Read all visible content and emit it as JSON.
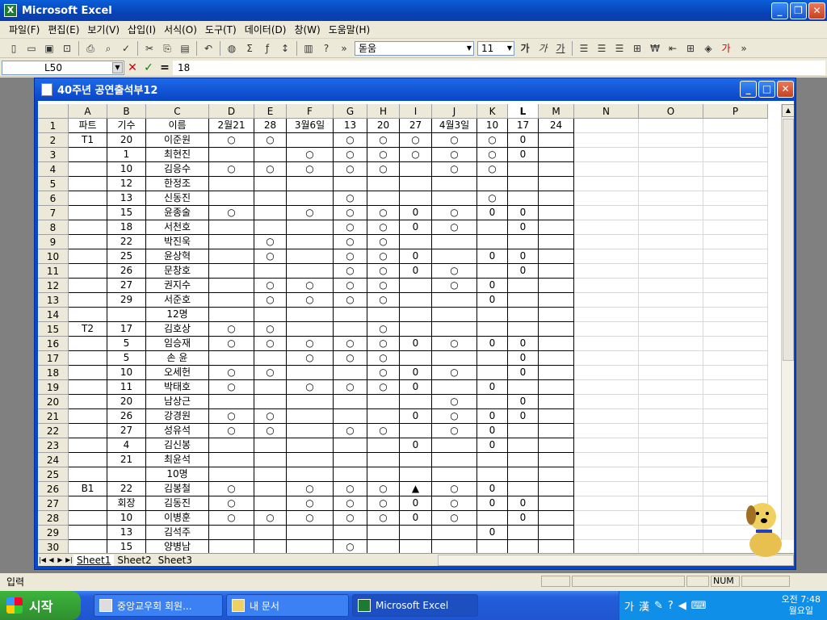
{
  "app": {
    "title": "Microsoft Excel"
  },
  "menu": [
    "파일(F)",
    "편집(E)",
    "보기(V)",
    "삽입(I)",
    "서식(O)",
    "도구(T)",
    "데이터(D)",
    "창(W)",
    "도움말(H)"
  ],
  "toolbar": {
    "font": "돋움",
    "size": "11",
    "bold": "가",
    "italic": "가",
    "underline": "가"
  },
  "formula": {
    "cell": "L50",
    "value": "18",
    "cancel": "✕",
    "enter": "✓",
    "eq": "="
  },
  "workbook": {
    "title": "40주년 공연출석부12"
  },
  "columns": [
    "A",
    "B",
    "C",
    "D",
    "E",
    "F",
    "G",
    "H",
    "I",
    "J",
    "K",
    "L",
    "M",
    "N",
    "O",
    "P"
  ],
  "rows": [
    {
      "n": "1",
      "cells": [
        "파트",
        "기수",
        "이름",
        "2월21",
        "28",
        "3월6일",
        "13",
        "20",
        "27",
        "4월3일",
        "10",
        "17",
        "24"
      ]
    },
    {
      "n": "2",
      "cells": [
        "T1",
        "20",
        "이준원",
        "○",
        "○",
        "",
        "○",
        "○",
        "○",
        "○",
        "○",
        "0",
        ""
      ]
    },
    {
      "n": "3",
      "cells": [
        "",
        "1",
        "최현진",
        "",
        "",
        "○",
        "○",
        "○",
        "○",
        "○",
        "○",
        "0",
        ""
      ]
    },
    {
      "n": "4",
      "cells": [
        "",
        "10",
        "김응수",
        "○",
        "○",
        "○",
        "○",
        "○",
        "",
        "○",
        "○",
        "",
        ""
      ]
    },
    {
      "n": "5",
      "cells": [
        "",
        "12",
        "한정조",
        "",
        "",
        "",
        "",
        "",
        "",
        "",
        "",
        "",
        ""
      ]
    },
    {
      "n": "6",
      "cells": [
        "",
        "13",
        "신동진",
        "",
        "",
        "",
        "○",
        "",
        "",
        "",
        "○",
        "",
        ""
      ]
    },
    {
      "n": "7",
      "cells": [
        "",
        "15",
        "윤종술",
        "○",
        "",
        "○",
        "○",
        "○",
        "0",
        "○",
        "0",
        "0",
        ""
      ]
    },
    {
      "n": "8",
      "cells": [
        "",
        "18",
        "서천호",
        "",
        "",
        "",
        "○",
        "○",
        "0",
        "○",
        "",
        "0",
        ""
      ]
    },
    {
      "n": "9",
      "cells": [
        "",
        "22",
        "박진욱",
        "",
        "○",
        "",
        "○",
        "○",
        "",
        "",
        "",
        "",
        ""
      ]
    },
    {
      "n": "10",
      "cells": [
        "",
        "25",
        "윤상혁",
        "",
        "○",
        "",
        "○",
        "○",
        "0",
        "",
        "0",
        "0",
        ""
      ]
    },
    {
      "n": "11",
      "cells": [
        "",
        "26",
        "문창호",
        "",
        "",
        "",
        "○",
        "○",
        "0",
        "○",
        "",
        "0",
        ""
      ]
    },
    {
      "n": "12",
      "cells": [
        "",
        "27",
        "권지수",
        "",
        "○",
        "○",
        "○",
        "○",
        "",
        "○",
        "0",
        "",
        ""
      ]
    },
    {
      "n": "13",
      "cells": [
        "",
        "29",
        "서준호",
        "",
        "○",
        "○",
        "○",
        "○",
        "",
        "",
        "0",
        "",
        ""
      ]
    },
    {
      "n": "14",
      "cells": [
        "",
        "",
        "12명",
        "",
        "",
        "",
        "",
        "",
        "",
        "",
        "",
        "",
        ""
      ]
    },
    {
      "n": "15",
      "cells": [
        "T2",
        "17",
        "김호상",
        "○",
        "○",
        "",
        "",
        "○",
        "",
        "",
        "",
        "",
        ""
      ]
    },
    {
      "n": "16",
      "cells": [
        "",
        "5",
        "임승재",
        "○",
        "○",
        "○",
        "○",
        "○",
        "0",
        "○",
        "0",
        "0",
        ""
      ]
    },
    {
      "n": "17",
      "cells": [
        "",
        "5",
        "손 윤",
        "",
        "",
        "○",
        "○",
        "○",
        "",
        "",
        "",
        "0",
        ""
      ]
    },
    {
      "n": "18",
      "cells": [
        "",
        "10",
        "오세헌",
        "○",
        "○",
        "",
        "",
        "○",
        "0",
        "○",
        "",
        "0",
        ""
      ]
    },
    {
      "n": "19",
      "cells": [
        "",
        "11",
        "박태호",
        "○",
        "",
        "○",
        "○",
        "○",
        "0",
        "",
        "0",
        "",
        ""
      ]
    },
    {
      "n": "20",
      "cells": [
        "",
        "20",
        "남상근",
        "",
        "",
        "",
        "",
        "",
        "",
        "○",
        "",
        "0",
        ""
      ]
    },
    {
      "n": "21",
      "cells": [
        "",
        "26",
        "강경원",
        "○",
        "○",
        "",
        "",
        "",
        "0",
        "○",
        "0",
        "0",
        ""
      ]
    },
    {
      "n": "22",
      "cells": [
        "",
        "27",
        "성유석",
        "○",
        "○",
        "",
        "○",
        "○",
        "",
        "○",
        "0",
        "",
        ""
      ]
    },
    {
      "n": "23",
      "cells": [
        "",
        "4",
        "김신봉",
        "",
        "",
        "",
        "",
        "",
        "0",
        "",
        "0",
        "",
        ""
      ]
    },
    {
      "n": "24",
      "cells": [
        "",
        "21",
        "최윤석",
        "",
        "",
        "",
        "",
        "",
        "",
        "",
        "",
        "",
        ""
      ]
    },
    {
      "n": "25",
      "cells": [
        "",
        "",
        "10명",
        "",
        "",
        "",
        "",
        "",
        "",
        "",
        "",
        "",
        ""
      ]
    },
    {
      "n": "26",
      "cells": [
        "B1",
        "22",
        "김봉철",
        "○",
        "",
        "○",
        "○",
        "○",
        "▲",
        "○",
        "0",
        "",
        ""
      ]
    },
    {
      "n": "27",
      "cells": [
        "",
        "회장",
        "김동진",
        "○",
        "",
        "○",
        "○",
        "○",
        "0",
        "○",
        "0",
        "0",
        ""
      ]
    },
    {
      "n": "28",
      "cells": [
        "",
        "10",
        "이병훈",
        "○",
        "○",
        "○",
        "○",
        "○",
        "0",
        "○",
        "",
        "0",
        ""
      ]
    },
    {
      "n": "29",
      "cells": [
        "",
        "13",
        "김석주",
        "",
        "",
        "",
        "",
        "",
        "",
        "",
        "0",
        "",
        ""
      ]
    },
    {
      "n": "30",
      "cells": [
        "",
        "15",
        "양병남",
        "",
        "",
        "",
        "○",
        "",
        "",
        "",
        "",
        "",
        ""
      ]
    }
  ],
  "sheets": [
    "Sheet1",
    "Sheet2",
    "Sheet3"
  ],
  "status": {
    "mode": "입력",
    "num": "NUM"
  },
  "taskbar": {
    "start": "시작",
    "items": [
      "중앙교우회 회원...",
      "내 문서",
      "Microsoft Excel"
    ],
    "ime1": "가",
    "ime2": "漢",
    "time": "오전 7:48",
    "day": "월요일"
  }
}
